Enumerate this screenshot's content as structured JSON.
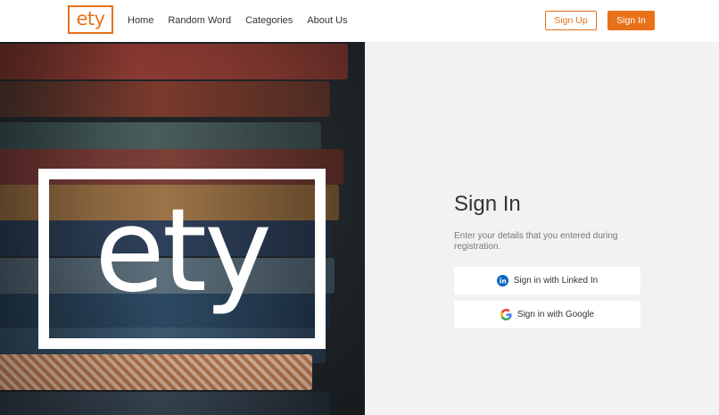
{
  "logo": {
    "text": "ety"
  },
  "nav": {
    "items": [
      {
        "label": "Home"
      },
      {
        "label": "Random Word"
      },
      {
        "label": "Categories"
      },
      {
        "label": "About Us"
      }
    ]
  },
  "header": {
    "signup_label": "Sign Up",
    "signin_label": "Sign In"
  },
  "hero": {
    "overlay_text": "ety"
  },
  "signin": {
    "title": "Sign In",
    "description": "Enter your details that you entered during registration.",
    "linkedin_label": "Sign in with Linked In",
    "google_label": "Sign in with Google"
  },
  "colors": {
    "accent": "#e8711a",
    "linkedin": "#0a66c2"
  },
  "icons": {
    "linkedin": "linkedin-icon",
    "google": "google-icon"
  }
}
